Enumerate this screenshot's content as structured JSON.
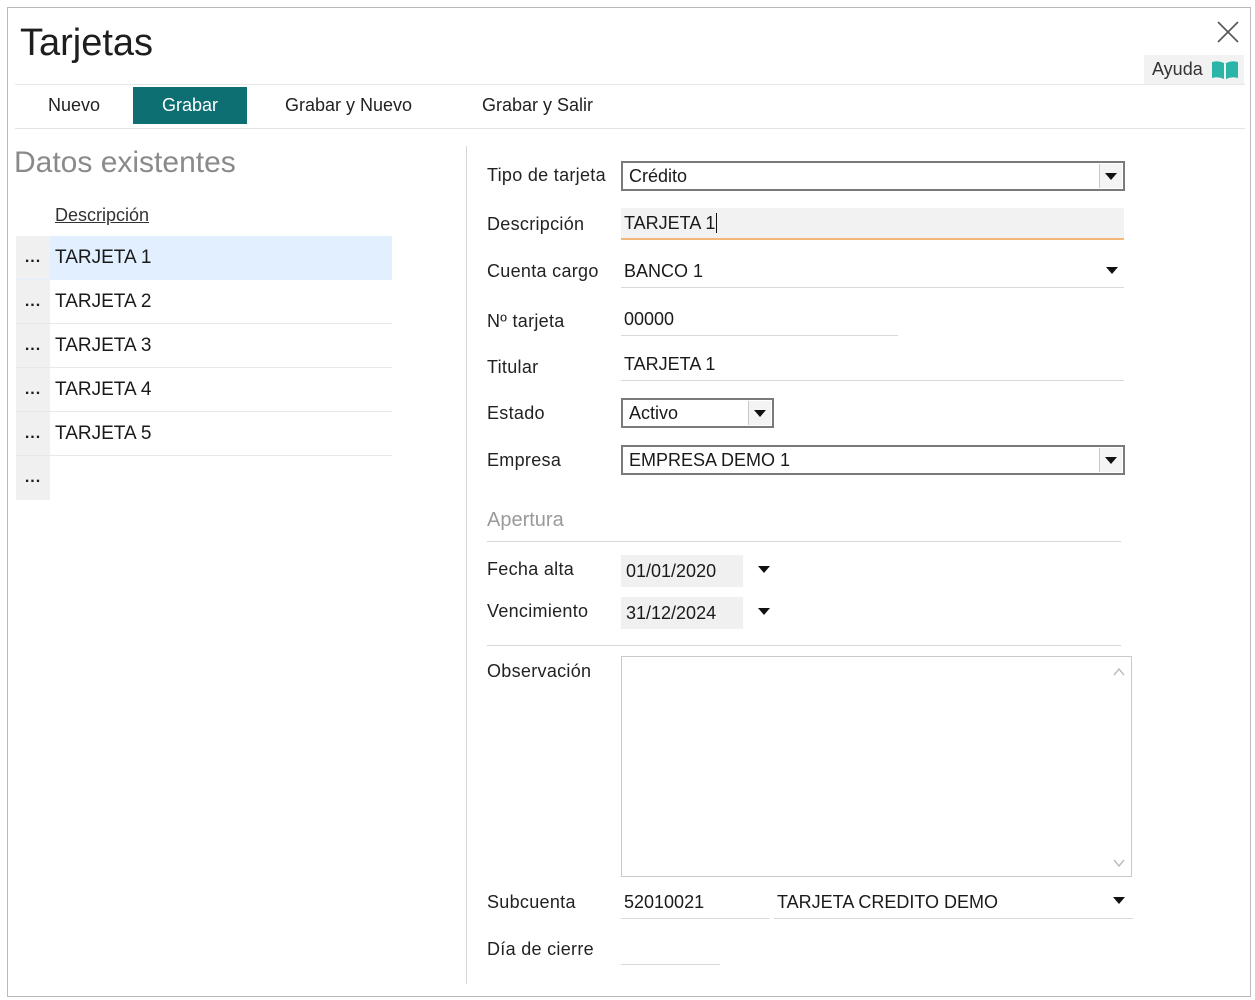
{
  "window": {
    "title": "Tarjetas",
    "help_label": "Ayuda"
  },
  "toolbar": [
    {
      "label": "Nuevo",
      "active": false
    },
    {
      "label": "Grabar",
      "active": true
    },
    {
      "label": "Grabar y Nuevo",
      "active": false
    },
    {
      "label": "Grabar y Salir",
      "active": false
    }
  ],
  "left_panel": {
    "title": "Datos existentes",
    "column_header": "Descripción",
    "row_marker": "...",
    "rows": [
      "TARJETA 1",
      "TARJETA 2",
      "TARJETA 3",
      "TARJETA 4",
      "TARJETA 5"
    ],
    "selected_index": 0
  },
  "form": {
    "tipo_tarjeta": {
      "label": "Tipo de tarjeta",
      "value": "Crédito"
    },
    "descripcion": {
      "label": "Descripción",
      "value": "TARJETA 1"
    },
    "cuenta_cargo": {
      "label": "Cuenta cargo",
      "value": "BANCO 1"
    },
    "num_tarjeta": {
      "label": "Nº tarjeta",
      "value": "00000"
    },
    "titular": {
      "label": "Titular",
      "value": "TARJETA 1"
    },
    "estado": {
      "label": "Estado",
      "value": "Activo"
    },
    "empresa": {
      "label": "Empresa",
      "value": "EMPRESA DEMO 1"
    },
    "apertura_section": "Apertura",
    "fecha_alta": {
      "label": "Fecha alta",
      "value": "01/01/2020"
    },
    "vencimiento": {
      "label": "Vencimiento",
      "value": "31/12/2024"
    },
    "observacion": {
      "label": "Observación",
      "value": ""
    },
    "subcuenta": {
      "label": "Subcuenta",
      "code": "52010021",
      "name": "TARJETA CREDITO DEMO"
    },
    "dia_cierre": {
      "label": "Día de cierre",
      "value": ""
    }
  },
  "colors": {
    "accent": "#0e6f73",
    "selection": "#e1efff",
    "help_icon": "#2bb5a8",
    "focus_border": "#f2b87a"
  }
}
